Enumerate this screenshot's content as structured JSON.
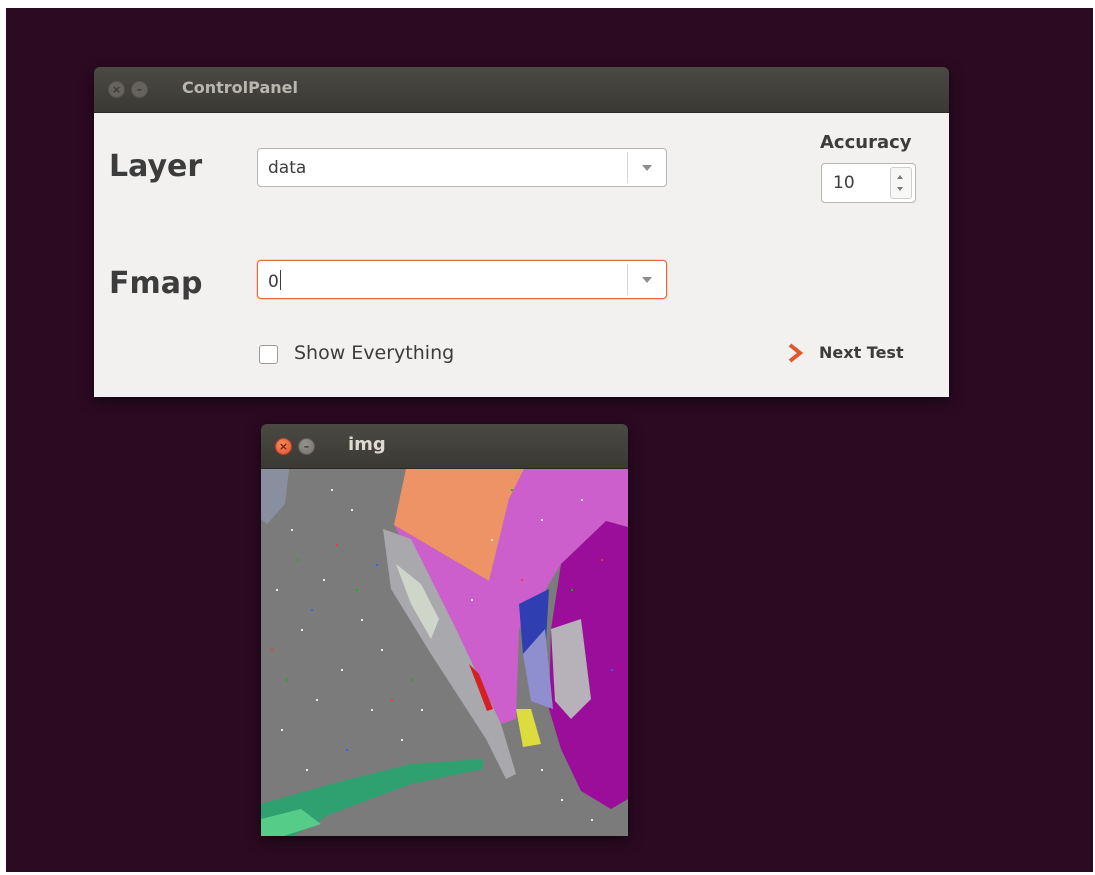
{
  "control_panel": {
    "title": "ControlPanel",
    "layer": {
      "label": "Layer",
      "value": "data"
    },
    "fmap": {
      "label": "Fmap",
      "value": "0"
    },
    "accuracy": {
      "label": "Accuracy",
      "value": "10"
    },
    "show_everything": {
      "label": "Show Everything",
      "checked": false
    },
    "next_test": {
      "label": "Next Test",
      "icon": "chevron-right-icon",
      "icon_color": "#e2572b"
    }
  },
  "img_window": {
    "title": "img"
  },
  "colors": {
    "desktop": "#2c0a22",
    "titlebar": "#3c3b37",
    "window_body": "#f2f1f0",
    "focus_border": "#e06d3f",
    "close_button": "#e2512b"
  }
}
